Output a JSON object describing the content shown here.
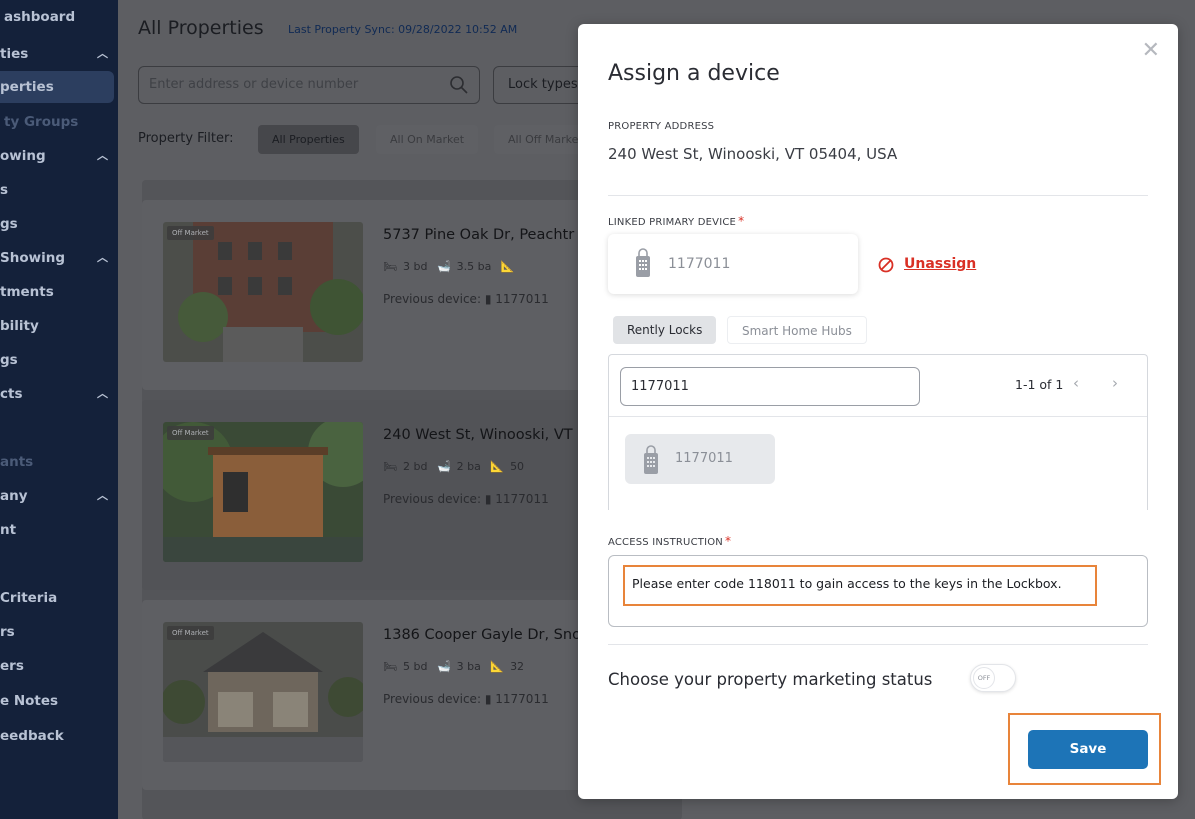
{
  "sidebar": {
    "items": [
      {
        "label": "ashboard",
        "chevron": false,
        "dim": false
      },
      {
        "label": "ties",
        "chevron": true,
        "dim": false
      },
      {
        "label": "perties",
        "chevron": false,
        "dim": false,
        "active": true
      },
      {
        "label": "ty Groups",
        "chevron": false,
        "dim": true
      },
      {
        "label": "owing",
        "chevron": true,
        "dim": false
      },
      {
        "label": "s",
        "chevron": false,
        "dim": false
      },
      {
        "label": "gs",
        "chevron": false,
        "dim": false
      },
      {
        "label": "Showing",
        "chevron": true,
        "dim": false
      },
      {
        "label": "tments",
        "chevron": false,
        "dim": false
      },
      {
        "label": "bility",
        "chevron": false,
        "dim": false
      },
      {
        "label": "gs",
        "chevron": false,
        "dim": false
      },
      {
        "label": "cts",
        "chevron": true,
        "dim": false
      },
      {
        "label": "ants",
        "chevron": false,
        "dim": true
      },
      {
        "label": "any",
        "chevron": true,
        "dim": false
      },
      {
        "label": "nt",
        "chevron": false,
        "dim": false
      },
      {
        "label": "Criteria",
        "chevron": false,
        "dim": false
      },
      {
        "label": "rs",
        "chevron": false,
        "dim": false
      },
      {
        "label": "ers",
        "chevron": false,
        "dim": false
      },
      {
        "label": "e Notes",
        "chevron": false,
        "dim": false
      },
      {
        "label": "eedback",
        "chevron": false,
        "dim": false
      }
    ]
  },
  "main": {
    "title": "All Properties",
    "sync": "Last Property Sync: 09/28/2022 10:52 AM",
    "search_placeholder": "Enter address or device number",
    "lock_types": "Lock types",
    "property_filter_label": "Property Filter:",
    "filters": [
      "All Properties",
      "All On Market",
      "All Off Market"
    ],
    "cards": [
      {
        "badge": "Off Market",
        "address": "5737 Pine Oak Dr, Peachtr",
        "beds": "3 bd",
        "baths": "3.5 ba",
        "prev_label": "Previous device:",
        "prev_device": "1177011"
      },
      {
        "badge": "Off Market",
        "address": "240 West St, Winooski, VT",
        "beds": "2 bd",
        "baths": "2 ba",
        "sqft": "50",
        "prev_label": "Previous device:",
        "prev_device": "1177011"
      },
      {
        "badge": "Off Market",
        "address": "1386 Cooper Gayle Dr, Sno",
        "beds": "5 bd",
        "baths": "3 ba",
        "sqft": "32",
        "prev_label": "Previous device:",
        "prev_device": "1177011"
      }
    ]
  },
  "modal": {
    "title": "Assign a device",
    "property_address_label": "PROPERTY ADDRESS",
    "property_address": "240 West St, Winooski, VT 05404, USA",
    "linked_device_label": "LINKED PRIMARY DEVICE",
    "linked_device": "1177011",
    "unassign": "Unassign",
    "tabs": [
      "Rently Locks",
      "Smart Home Hubs"
    ],
    "search_value": "1177011",
    "page_count": "1-1 of 1",
    "result_device": "1177011",
    "access_label": "ACCESS INSTRUCTION",
    "access_text": "Please enter code 118011 to gain access to the keys in the Lockbox.",
    "marketing_label": "Choose your property marketing status",
    "toggle_text": "OFF",
    "save": "Save"
  },
  "colors": {
    "accent": "#1d74b7",
    "highlight": "#e8843a",
    "danger": "#d93025",
    "sidebar": "#14213a"
  }
}
